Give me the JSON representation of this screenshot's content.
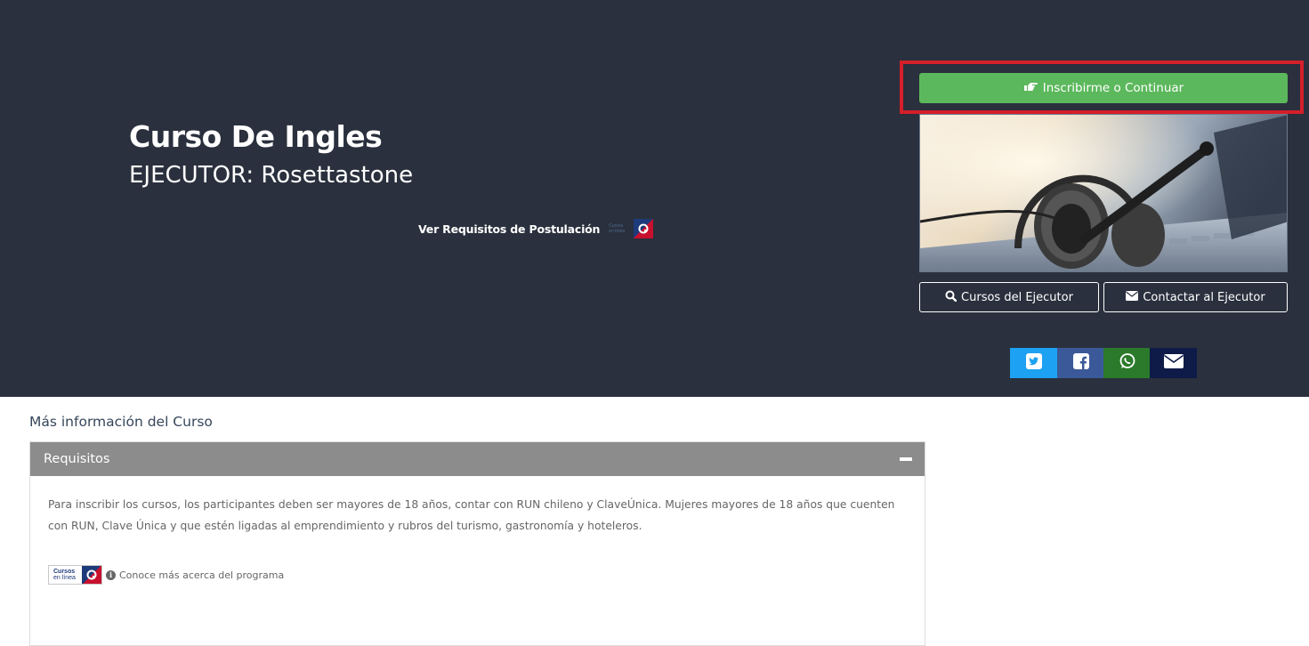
{
  "hero": {
    "course_title": "Curso De Ingles",
    "executor_line": "EJECUTOR: Rosettastone",
    "requirements_link": "Ver Requisitos de Postulación"
  },
  "actions": {
    "enroll_label": "Inscribirme o Continuar",
    "executor_courses_label": "Cursos del Ejecutor",
    "contact_executor_label": "Contactar al Ejecutor"
  },
  "share": {
    "items": [
      {
        "icon": "twitter-icon",
        "color": "#1da1f2"
      },
      {
        "icon": "facebook-icon",
        "color": "#3b5998"
      },
      {
        "icon": "whatsapp-icon",
        "color": "#2b7a2b"
      },
      {
        "icon": "envelope-icon",
        "color": "#0e1a47"
      }
    ]
  },
  "info": {
    "section_title": "Más información del Curso",
    "panel_title": "Requisitos",
    "panel_text": "Para inscribir los cursos, los participantes deben ser mayores de 18 años, contar con RUN chileno y ClaveÚnica. Mujeres mayores de 18 años que cuenten con RUN, Clave Única y que estén ligadas al emprendimiento y rubros del turismo, gastronomía y hoteleros.",
    "logo_line1": "Cursos",
    "logo_line2": "en línea",
    "program_link": "Conoce más acerca del programa"
  },
  "colors": {
    "hero_bg": "#2a303d",
    "enroll_green": "#5cb85c",
    "highlight_red": "#d51f2a",
    "panel_header": "#8c8c8c"
  }
}
